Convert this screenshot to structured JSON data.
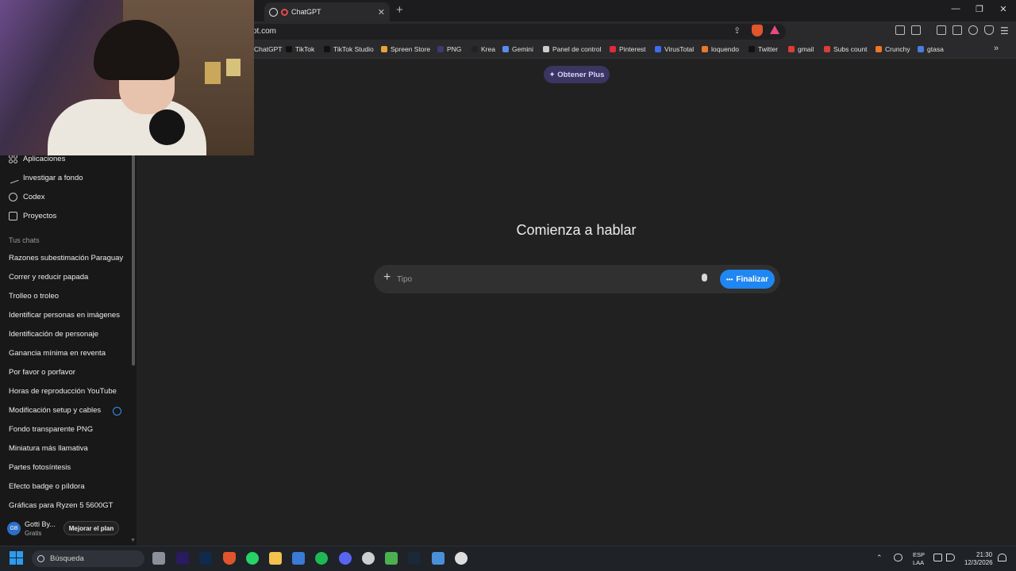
{
  "browser": {
    "tab_title": "ChatGPT",
    "url_fragment": "ot.com",
    "bookmarks": [
      {
        "label": "ChatGPT",
        "color": "#555555"
      },
      {
        "label": "TikTok",
        "color": "#111111"
      },
      {
        "label": "TikTok Studio",
        "color": "#111111"
      },
      {
        "label": "Spreen Store",
        "color": "#e8a33c"
      },
      {
        "label": "PNG",
        "color": "#3b3b6e"
      },
      {
        "label": "Krea",
        "color": "#222222"
      },
      {
        "label": "Gemini",
        "color": "#5a8cf0"
      },
      {
        "label": "Panel de control",
        "color": "#cccccc"
      },
      {
        "label": "Pinterest",
        "color": "#e02a3a"
      },
      {
        "label": "VirusTotal",
        "color": "#3c6df0"
      },
      {
        "label": "loquendo",
        "color": "#e87a2c"
      },
      {
        "label": "Twitter",
        "color": "#111111"
      },
      {
        "label": "gmail",
        "color": "#d93f34"
      },
      {
        "label": "Subs count",
        "color": "#d93f34"
      },
      {
        "label": "Crunchy",
        "color": "#f47521"
      },
      {
        "label": "gtasa",
        "color": "#4a7de0"
      }
    ]
  },
  "sidebar": {
    "nav": [
      {
        "label": "Aplicaciones",
        "icon": "apps-icon"
      },
      {
        "label": "Investigar a fondo",
        "icon": "telescope-icon"
      },
      {
        "label": "Codex",
        "icon": "codex-icon"
      },
      {
        "label": "Proyectos",
        "icon": "folder-icon"
      }
    ],
    "chats_heading": "Tus chats",
    "chats": [
      "Razones subestimación Paraguay",
      "Correr y reducir papada",
      "Trolleo o troleo",
      "Identificar personas en imágenes",
      "Identificación de personaje",
      "Ganancia mínima en reventa",
      "Por favor o porfavor",
      "Horas de reproducción YouTube",
      "Modificación setup y cables",
      "Fondo transparente PNG",
      "Miniatura más llamativa",
      "Partes fotosíntesis",
      "Efecto badge o píldora",
      "Gráficas para Ryzen 5 5600GT"
    ],
    "user": {
      "initials": "GB",
      "name": "Gotti By...",
      "plan": "Gratis",
      "upgrade_label": "Mejorar el plan"
    }
  },
  "main": {
    "plus_button": "✦ Obtener Plus",
    "heading": "Comienza a hablar",
    "composer": {
      "placeholder": "Tipo",
      "finalize_label": "Finalizar"
    }
  },
  "taskbar": {
    "search_label": "Búsqueda",
    "lang_line1": "ESP",
    "lang_line2": "LAA",
    "time": "21:30",
    "date": "12/3/2026"
  },
  "colors": {
    "accent": "#1f86f2",
    "plus_bg": "#3a3561",
    "sidebar_bg": "#181818",
    "main_bg": "#212121"
  }
}
